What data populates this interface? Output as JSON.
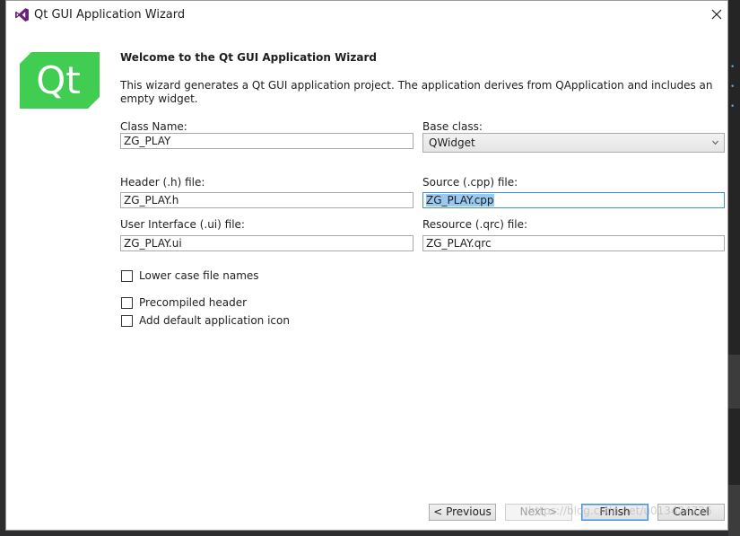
{
  "window": {
    "title": "Qt GUI Application Wizard",
    "app_icon": "visual-studio-icon",
    "close_icon": "close-icon"
  },
  "logo": {
    "text": "Qt",
    "color": "#41cd52"
  },
  "page": {
    "heading": "Welcome to the Qt GUI Application Wizard",
    "description": "This wizard generates a Qt GUI application project. The application derives from QApplication and includes an empty widget."
  },
  "form": {
    "class_name": {
      "label": "Class Name:",
      "value": "ZG_PLAY"
    },
    "base_class": {
      "label": "Base class:",
      "value": "QWidget"
    },
    "header_file": {
      "label": "Header (.h) file:",
      "value": "ZG_PLAY.h"
    },
    "source_file": {
      "label": "Source (.cpp) file:",
      "value": "ZG_PLAY.cpp"
    },
    "ui_file": {
      "label": "User Interface (.ui) file:",
      "value": "ZG_PLAY.ui"
    },
    "resource_file": {
      "label": "Resource (.qrc) file:",
      "value": "ZG_PLAY.qrc"
    }
  },
  "options": {
    "lower_case": {
      "label": "Lower case file names",
      "checked": false
    },
    "precompiled": {
      "label": "Precompiled header",
      "checked": false
    },
    "default_icon": {
      "label": "Add default application icon",
      "checked": false
    }
  },
  "buttons": {
    "previous": "< Previous",
    "next": "Next >",
    "finish": "Finish",
    "cancel": "Cancel"
  },
  "watermark": "https://blog.csdn.net/u013424726"
}
